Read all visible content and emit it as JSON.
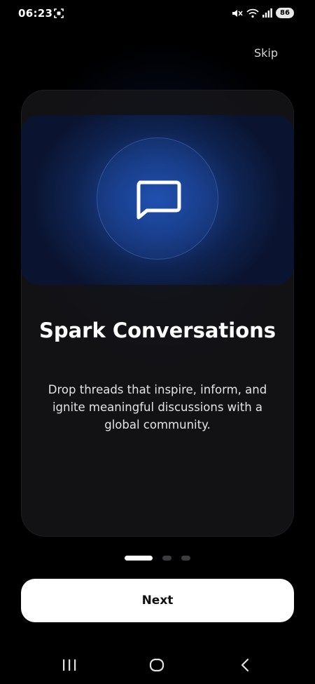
{
  "status_bar": {
    "time": "06:23",
    "battery": "86"
  },
  "header": {
    "skip_label": "Skip"
  },
  "onboarding": {
    "icon": "chat-bubble-icon",
    "title": "Spark Conversations",
    "description": "Drop threads that inspire, inform, and ignite meaningful discussions with a global community.",
    "current_page": 1,
    "total_pages": 3
  },
  "footer": {
    "next_label": "Next"
  },
  "colors": {
    "background": "#000000",
    "accent_blue": "#1f4fae",
    "button_bg": "#ffffff",
    "button_text": "#111111"
  }
}
